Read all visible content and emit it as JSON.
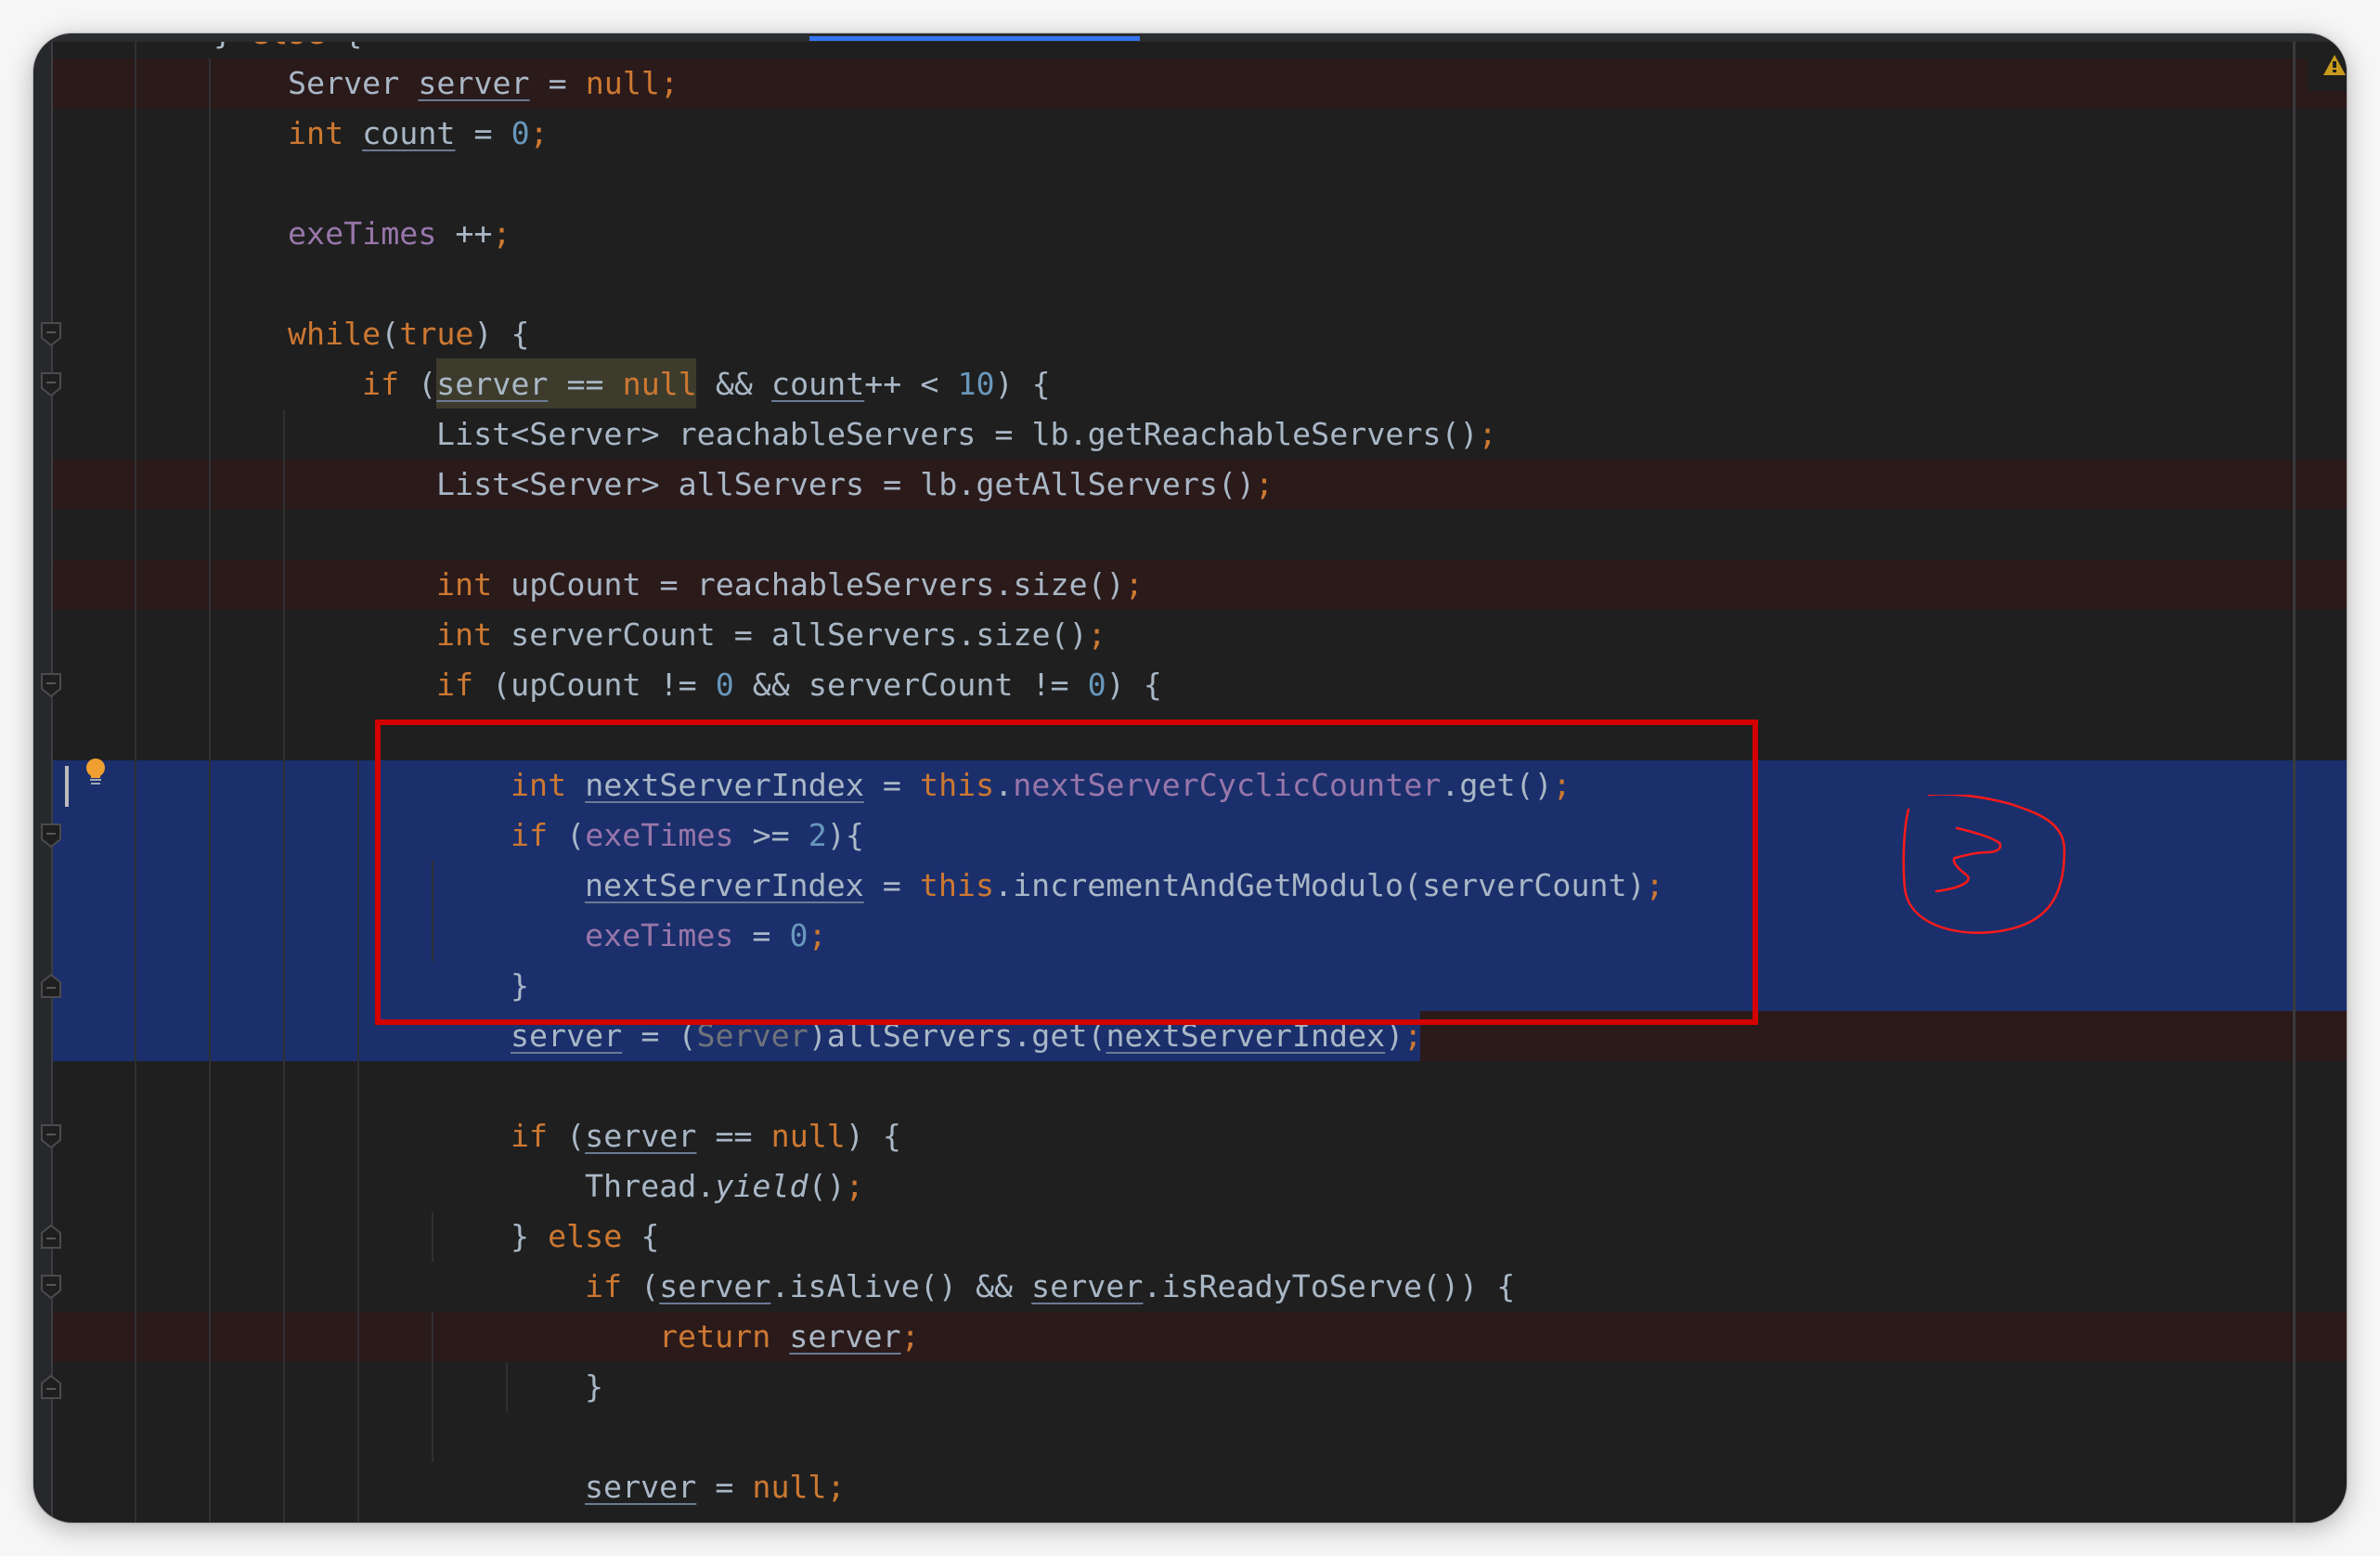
{
  "editor": {
    "language": "Java",
    "palette": {
      "background": "#1f1f1f",
      "selection": "#1b2f6c",
      "error_row": "#2b1a1a",
      "annotation_red": "#d40000",
      "keyword": "#cc7832",
      "number": "#6897bb",
      "field": "#9876aa",
      "plain": "#a9b7c6",
      "warning": "#c99a1c"
    },
    "warning_indicator": "warning-triangle-icon",
    "intention_bulb": "lightbulb-icon",
    "lines": [
      {
        "tokens": [
          [
            "} ",
            "plain"
          ],
          [
            "else",
            "kw"
          ],
          [
            " {",
            "plain"
          ]
        ]
      },
      {
        "tokens": [
          [
            "Server ",
            "plain"
          ],
          [
            "server",
            "var"
          ],
          [
            " = ",
            "plain"
          ],
          [
            "null",
            "kw"
          ],
          [
            ";",
            "semi"
          ]
        ],
        "state": "err"
      },
      {
        "tokens": [
          [
            "int",
            "kw"
          ],
          [
            " ",
            "plain"
          ],
          [
            "count",
            "var"
          ],
          [
            " = ",
            "plain"
          ],
          [
            "0",
            "num"
          ],
          [
            ";",
            "semi"
          ]
        ]
      },
      {
        "tokens": []
      },
      {
        "tokens": [
          [
            "exeTimes",
            "field"
          ],
          [
            " ++",
            "plain"
          ],
          [
            ";",
            "semi"
          ]
        ]
      },
      {
        "tokens": []
      },
      {
        "tokens": [
          [
            "while",
            "kw"
          ],
          [
            "(",
            "plain"
          ],
          [
            "true",
            "kw"
          ],
          [
            ") {",
            "plain"
          ]
        ]
      },
      {
        "tokens": [
          [
            "if",
            "kw"
          ],
          [
            " (",
            "plain"
          ],
          [
            "server",
            "var"
          ],
          [
            " == ",
            "plain"
          ],
          [
            "null",
            "kw"
          ],
          [
            " && ",
            "plain"
          ],
          [
            "count",
            "var"
          ],
          [
            "++ < ",
            "plain"
          ],
          [
            "10",
            "num"
          ],
          [
            ") {",
            "plain"
          ]
        ]
      },
      {
        "tokens": [
          [
            "List<Server> reachableServers = lb.getReachableServers()",
            "plain"
          ],
          [
            ";",
            "semi"
          ]
        ]
      },
      {
        "tokens": [
          [
            "List<Server> allServers = lb.getAllServers()",
            "plain"
          ],
          [
            ";",
            "semi"
          ]
        ],
        "state": "err"
      },
      {
        "tokens": []
      },
      {
        "tokens": [
          [
            "int",
            "kw"
          ],
          [
            " upCount = reachableServers.size()",
            "plain"
          ],
          [
            ";",
            "semi"
          ]
        ],
        "state": "err"
      },
      {
        "tokens": [
          [
            "int",
            "kw"
          ],
          [
            " serverCount = allServers.size()",
            "plain"
          ],
          [
            ";",
            "semi"
          ]
        ]
      },
      {
        "tokens": [
          [
            "if",
            "kw"
          ],
          [
            " (upCount != ",
            "plain"
          ],
          [
            "0",
            "num"
          ],
          [
            " && serverCount != ",
            "plain"
          ],
          [
            "0",
            "num"
          ],
          [
            ") {",
            "plain"
          ]
        ]
      },
      {
        "tokens": []
      },
      {
        "tokens": [
          [
            "int",
            "kw"
          ],
          [
            " ",
            "plain"
          ],
          [
            "nextServerIndex",
            "var"
          ],
          [
            " = ",
            "plain"
          ],
          [
            "this",
            "kw"
          ],
          [
            ".",
            "plain"
          ],
          [
            "nextServerCyclicCounter",
            "field"
          ],
          [
            ".get()",
            "plain"
          ],
          [
            ";",
            "semi"
          ]
        ],
        "state": "sel"
      },
      {
        "tokens": [
          [
            "if",
            "kw"
          ],
          [
            " (",
            "plain"
          ],
          [
            "exeTimes",
            "field"
          ],
          [
            " >= ",
            "plain"
          ],
          [
            "2",
            "num"
          ],
          [
            "){",
            "plain"
          ]
        ],
        "state": "sel"
      },
      {
        "tokens": [
          [
            "nextServerIndex",
            "var"
          ],
          [
            " = ",
            "plain"
          ],
          [
            "this",
            "kw"
          ],
          [
            ".incrementAndGetModulo(serverCount)",
            "plain"
          ],
          [
            ";",
            "semi"
          ]
        ],
        "state": "sel"
      },
      {
        "tokens": [
          [
            "exeTimes",
            "field"
          ],
          [
            " = ",
            "plain"
          ],
          [
            "0",
            "num"
          ],
          [
            ";",
            "semi"
          ]
        ],
        "state": "sel"
      },
      {
        "tokens": [
          [
            "}",
            "plain"
          ]
        ],
        "state": "sel"
      },
      {
        "tokens": [
          [
            "server",
            "var"
          ],
          [
            " = (",
            "plain"
          ],
          [
            "Server",
            "muted"
          ],
          [
            ")allServers.get(",
            "plain"
          ],
          [
            "nextServerIndex",
            "var"
          ],
          [
            ")",
            "plain"
          ],
          [
            ";",
            "semi"
          ]
        ],
        "state": "partial-sel"
      },
      {
        "tokens": []
      },
      {
        "tokens": [
          [
            "if",
            "kw"
          ],
          [
            " (",
            "plain"
          ],
          [
            "server",
            "var"
          ],
          [
            " == ",
            "plain"
          ],
          [
            "null",
            "kw"
          ],
          [
            ") {",
            "plain"
          ]
        ]
      },
      {
        "tokens": [
          [
            "Thread.",
            "plain"
          ],
          [
            "yield",
            "italic"
          ],
          [
            "()",
            "plain"
          ],
          [
            ";",
            "semi"
          ]
        ]
      },
      {
        "tokens": [
          [
            "} ",
            "plain"
          ],
          [
            "else",
            "kw"
          ],
          [
            " {",
            "plain"
          ]
        ]
      },
      {
        "tokens": [
          [
            "if",
            "kw"
          ],
          [
            " (",
            "plain"
          ],
          [
            "server",
            "var"
          ],
          [
            ".isAlive() && ",
            "plain"
          ],
          [
            "server",
            "var"
          ],
          [
            ".isReadyToServe()) {",
            "plain"
          ]
        ]
      },
      {
        "tokens": [
          [
            "return",
            "kw"
          ],
          [
            " ",
            "plain"
          ],
          [
            "server",
            "var"
          ],
          [
            ";",
            "semi"
          ]
        ],
        "state": "err"
      },
      {
        "tokens": [
          [
            "}",
            "plain"
          ]
        ]
      },
      {
        "tokens": []
      },
      {
        "tokens": [
          [
            "server",
            "var"
          ],
          [
            " = ",
            "plain"
          ],
          [
            "null",
            "kw"
          ],
          [
            ";",
            "semi"
          ]
        ]
      }
    ]
  },
  "annotation": {
    "box": "red-rectangle",
    "label": "3"
  }
}
